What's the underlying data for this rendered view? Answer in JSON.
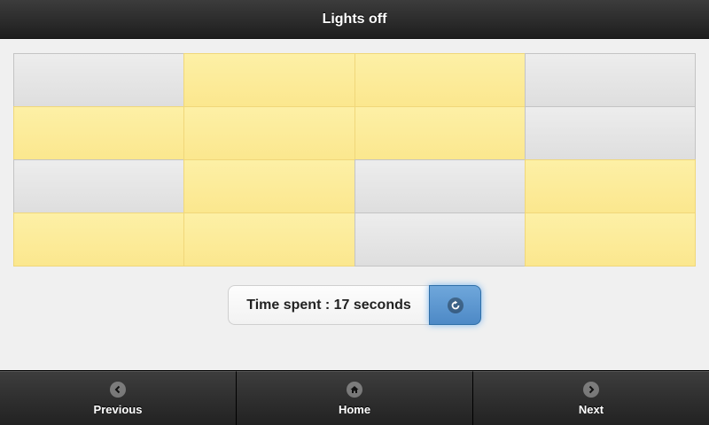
{
  "header": {
    "title": "Lights off"
  },
  "board": {
    "rows": 4,
    "cols": 4,
    "cells": [
      [
        false,
        true,
        true,
        false
      ],
      [
        true,
        true,
        true,
        false
      ],
      [
        false,
        true,
        false,
        true
      ],
      [
        true,
        true,
        false,
        true
      ]
    ],
    "colors": {
      "on": "#fbe78e",
      "off": "#e4e4e4"
    }
  },
  "timer": {
    "text": "Time spent : 17 seconds",
    "refresh_icon": "refresh-icon"
  },
  "footer": {
    "previous": {
      "label": "Previous",
      "icon": "chevron-left-icon"
    },
    "home": {
      "label": "Home",
      "icon": "home-icon"
    },
    "next": {
      "label": "Next",
      "icon": "chevron-right-icon"
    }
  }
}
